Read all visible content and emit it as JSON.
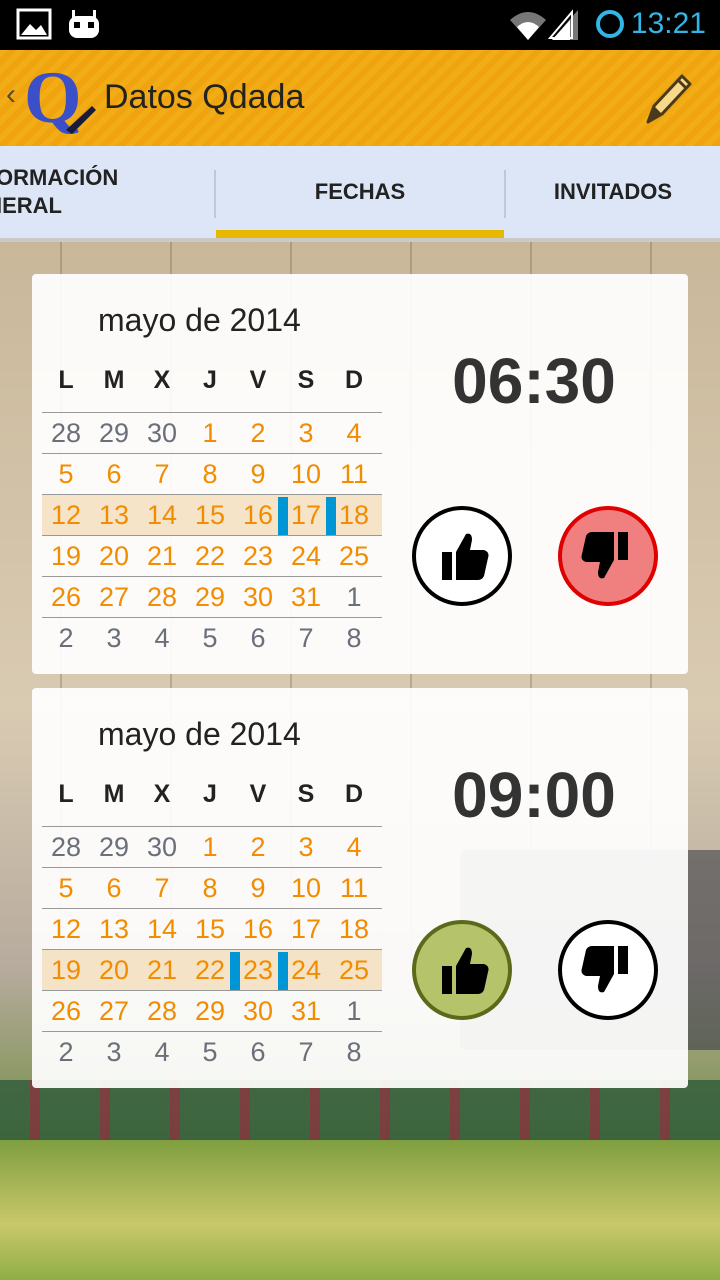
{
  "status": {
    "time": "13:21"
  },
  "actionbar": {
    "title": "Datos Qdada",
    "back_glyph": "‹",
    "logo": "Q",
    "edit_icon": "pencil-icon"
  },
  "tabs": [
    {
      "label": "ORMACIÓN\nIERAL",
      "active": false
    },
    {
      "label": "FECHAS",
      "active": true
    },
    {
      "label": "INVITADOS",
      "active": false
    }
  ],
  "dow": [
    "L",
    "M",
    "X",
    "J",
    "V",
    "S",
    "D"
  ],
  "colors": {
    "accent": "#f2ad16",
    "tab_bg": "#dce6f6",
    "indicator": "#e6b800",
    "current_month": "#f28c00",
    "other_month": "#6b6f7a",
    "range_mark": "#0096d6",
    "dislike_active": "#f08080",
    "like_active": "#b5c46a"
  },
  "cards": [
    {
      "month": "mayo de 2014",
      "time": "06:30",
      "like_active": false,
      "dislike_active": true,
      "weeks": [
        [
          "28",
          "29",
          "30",
          "1",
          "2",
          "3",
          "4"
        ],
        [
          "5",
          "6",
          "7",
          "8",
          "9",
          "10",
          "11"
        ],
        [
          "12",
          "13",
          "14",
          "15",
          "16",
          "17",
          "18"
        ],
        [
          "19",
          "20",
          "21",
          "22",
          "23",
          "24",
          "25"
        ],
        [
          "26",
          "27",
          "28",
          "29",
          "30",
          "31",
          "1"
        ],
        [
          "2",
          "3",
          "4",
          "5",
          "6",
          "7",
          "8"
        ]
      ],
      "selected_week": 2,
      "selected_days": [
        "17"
      ]
    },
    {
      "month": "mayo de 2014",
      "time": "09:00",
      "like_active": true,
      "dislike_active": false,
      "weeks": [
        [
          "28",
          "29",
          "30",
          "1",
          "2",
          "3",
          "4"
        ],
        [
          "5",
          "6",
          "7",
          "8",
          "9",
          "10",
          "11"
        ],
        [
          "12",
          "13",
          "14",
          "15",
          "16",
          "17",
          "18"
        ],
        [
          "19",
          "20",
          "21",
          "22",
          "23",
          "24",
          "25"
        ],
        [
          "26",
          "27",
          "28",
          "29",
          "30",
          "31",
          "1"
        ],
        [
          "2",
          "3",
          "4",
          "5",
          "6",
          "7",
          "8"
        ]
      ],
      "selected_week": 3,
      "selected_days": [
        "23"
      ]
    }
  ]
}
